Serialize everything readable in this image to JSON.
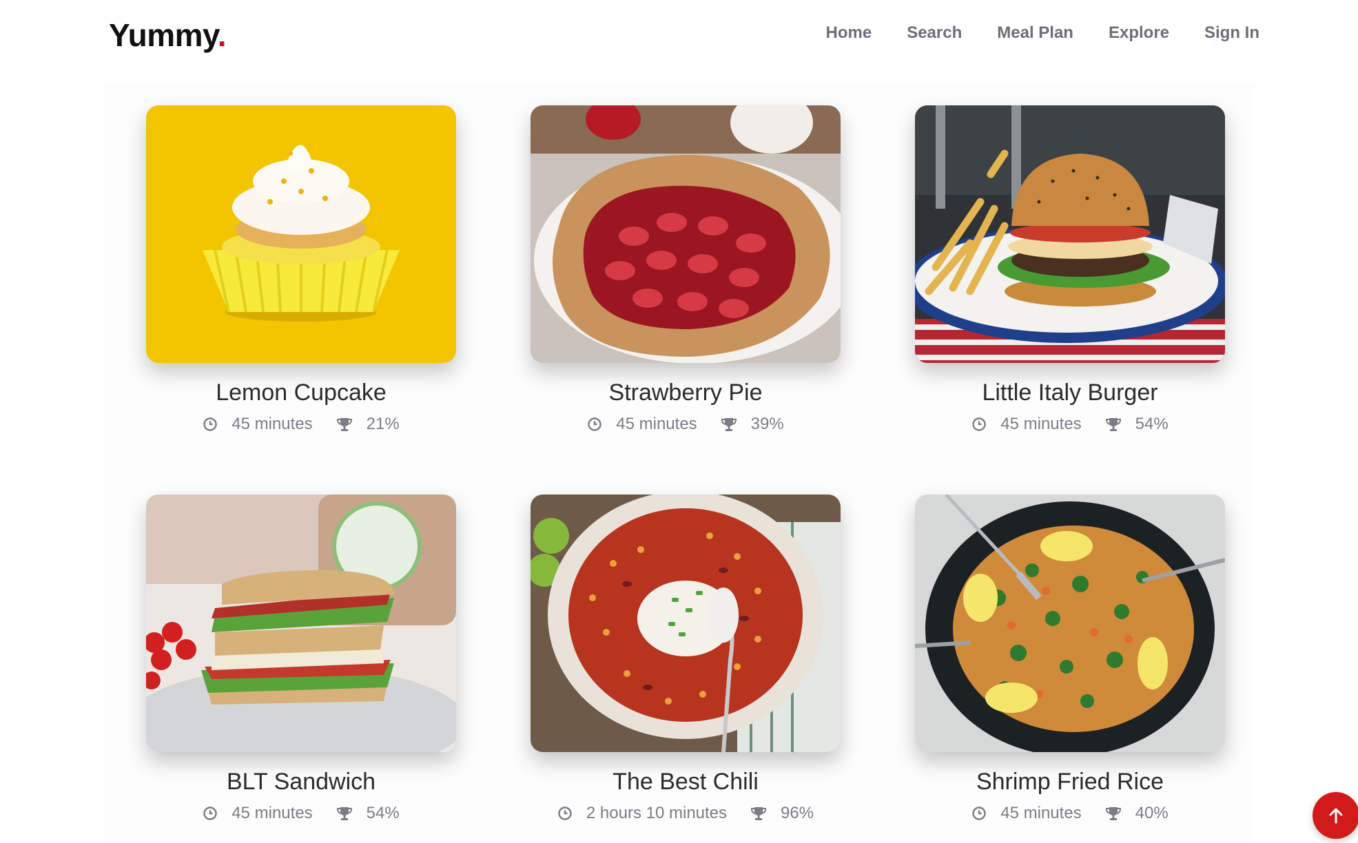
{
  "brand": {
    "name": "Yummy",
    "dot": ".",
    "accent": "#c8102e"
  },
  "nav": {
    "items": [
      {
        "label": "Home"
      },
      {
        "label": "Search"
      },
      {
        "label": "Meal Plan"
      },
      {
        "label": "Explore"
      },
      {
        "label": "Sign In"
      }
    ]
  },
  "recipes": [
    {
      "title": "Lemon Cupcake",
      "time": "45 minutes",
      "rating": "21%",
      "image": "lemon-cupcake-photo"
    },
    {
      "title": "Strawberry Pie",
      "time": "45 minutes",
      "rating": "39%",
      "image": "strawberry-pie-photo"
    },
    {
      "title": "Little Italy Burger",
      "time": "45 minutes",
      "rating": "54%",
      "image": "burger-photo"
    },
    {
      "title": "BLT Sandwich",
      "time": "45 minutes",
      "rating": "54%",
      "image": "blt-sandwich-photo"
    },
    {
      "title": "The Best Chili",
      "time": "2 hours 10 minutes",
      "rating": "96%",
      "image": "chili-photo"
    },
    {
      "title": "Shrimp Fried Rice",
      "time": "45 minutes",
      "rating": "40%",
      "image": "shrimp-fried-rice-photo"
    }
  ],
  "icons": {
    "time": "clock-icon",
    "rating": "trophy-icon",
    "scroll_top": "arrow-up-icon"
  },
  "colors": {
    "scroll_button": "#d11a1a",
    "nav_text": "#6b6f7a",
    "meta_text": "#7a7d86"
  }
}
